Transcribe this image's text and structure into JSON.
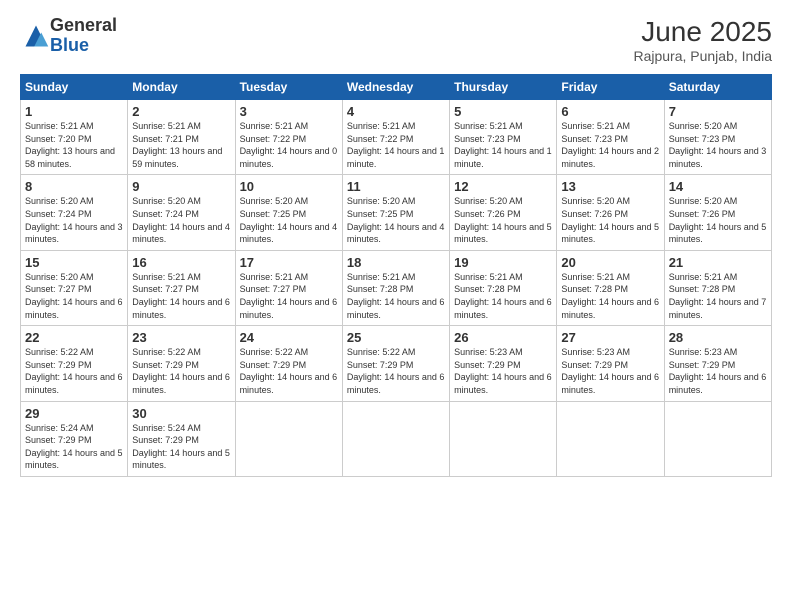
{
  "header": {
    "logo_general": "General",
    "logo_blue": "Blue",
    "month_year": "June 2025",
    "location": "Rajpura, Punjab, India"
  },
  "weekdays": [
    "Sunday",
    "Monday",
    "Tuesday",
    "Wednesday",
    "Thursday",
    "Friday",
    "Saturday"
  ],
  "weeks": [
    [
      {
        "day": "1",
        "sunrise": "Sunrise: 5:21 AM",
        "sunset": "Sunset: 7:20 PM",
        "daylight": "Daylight: 13 hours and 58 minutes."
      },
      {
        "day": "2",
        "sunrise": "Sunrise: 5:21 AM",
        "sunset": "Sunset: 7:21 PM",
        "daylight": "Daylight: 13 hours and 59 minutes."
      },
      {
        "day": "3",
        "sunrise": "Sunrise: 5:21 AM",
        "sunset": "Sunset: 7:22 PM",
        "daylight": "Daylight: 14 hours and 0 minutes."
      },
      {
        "day": "4",
        "sunrise": "Sunrise: 5:21 AM",
        "sunset": "Sunset: 7:22 PM",
        "daylight": "Daylight: 14 hours and 1 minute."
      },
      {
        "day": "5",
        "sunrise": "Sunrise: 5:21 AM",
        "sunset": "Sunset: 7:23 PM",
        "daylight": "Daylight: 14 hours and 1 minute."
      },
      {
        "day": "6",
        "sunrise": "Sunrise: 5:21 AM",
        "sunset": "Sunset: 7:23 PM",
        "daylight": "Daylight: 14 hours and 2 minutes."
      },
      {
        "day": "7",
        "sunrise": "Sunrise: 5:20 AM",
        "sunset": "Sunset: 7:23 PM",
        "daylight": "Daylight: 14 hours and 3 minutes."
      }
    ],
    [
      {
        "day": "8",
        "sunrise": "Sunrise: 5:20 AM",
        "sunset": "Sunset: 7:24 PM",
        "daylight": "Daylight: 14 hours and 3 minutes."
      },
      {
        "day": "9",
        "sunrise": "Sunrise: 5:20 AM",
        "sunset": "Sunset: 7:24 PM",
        "daylight": "Daylight: 14 hours and 4 minutes."
      },
      {
        "day": "10",
        "sunrise": "Sunrise: 5:20 AM",
        "sunset": "Sunset: 7:25 PM",
        "daylight": "Daylight: 14 hours and 4 minutes."
      },
      {
        "day": "11",
        "sunrise": "Sunrise: 5:20 AM",
        "sunset": "Sunset: 7:25 PM",
        "daylight": "Daylight: 14 hours and 4 minutes."
      },
      {
        "day": "12",
        "sunrise": "Sunrise: 5:20 AM",
        "sunset": "Sunset: 7:26 PM",
        "daylight": "Daylight: 14 hours and 5 minutes."
      },
      {
        "day": "13",
        "sunrise": "Sunrise: 5:20 AM",
        "sunset": "Sunset: 7:26 PM",
        "daylight": "Daylight: 14 hours and 5 minutes."
      },
      {
        "day": "14",
        "sunrise": "Sunrise: 5:20 AM",
        "sunset": "Sunset: 7:26 PM",
        "daylight": "Daylight: 14 hours and 5 minutes."
      }
    ],
    [
      {
        "day": "15",
        "sunrise": "Sunrise: 5:20 AM",
        "sunset": "Sunset: 7:27 PM",
        "daylight": "Daylight: 14 hours and 6 minutes."
      },
      {
        "day": "16",
        "sunrise": "Sunrise: 5:21 AM",
        "sunset": "Sunset: 7:27 PM",
        "daylight": "Daylight: 14 hours and 6 minutes."
      },
      {
        "day": "17",
        "sunrise": "Sunrise: 5:21 AM",
        "sunset": "Sunset: 7:27 PM",
        "daylight": "Daylight: 14 hours and 6 minutes."
      },
      {
        "day": "18",
        "sunrise": "Sunrise: 5:21 AM",
        "sunset": "Sunset: 7:28 PM",
        "daylight": "Daylight: 14 hours and 6 minutes."
      },
      {
        "day": "19",
        "sunrise": "Sunrise: 5:21 AM",
        "sunset": "Sunset: 7:28 PM",
        "daylight": "Daylight: 14 hours and 6 minutes."
      },
      {
        "day": "20",
        "sunrise": "Sunrise: 5:21 AM",
        "sunset": "Sunset: 7:28 PM",
        "daylight": "Daylight: 14 hours and 6 minutes."
      },
      {
        "day": "21",
        "sunrise": "Sunrise: 5:21 AM",
        "sunset": "Sunset: 7:28 PM",
        "daylight": "Daylight: 14 hours and 7 minutes."
      }
    ],
    [
      {
        "day": "22",
        "sunrise": "Sunrise: 5:22 AM",
        "sunset": "Sunset: 7:29 PM",
        "daylight": "Daylight: 14 hours and 6 minutes."
      },
      {
        "day": "23",
        "sunrise": "Sunrise: 5:22 AM",
        "sunset": "Sunset: 7:29 PM",
        "daylight": "Daylight: 14 hours and 6 minutes."
      },
      {
        "day": "24",
        "sunrise": "Sunrise: 5:22 AM",
        "sunset": "Sunset: 7:29 PM",
        "daylight": "Daylight: 14 hours and 6 minutes."
      },
      {
        "day": "25",
        "sunrise": "Sunrise: 5:22 AM",
        "sunset": "Sunset: 7:29 PM",
        "daylight": "Daylight: 14 hours and 6 minutes."
      },
      {
        "day": "26",
        "sunrise": "Sunrise: 5:23 AM",
        "sunset": "Sunset: 7:29 PM",
        "daylight": "Daylight: 14 hours and 6 minutes."
      },
      {
        "day": "27",
        "sunrise": "Sunrise: 5:23 AM",
        "sunset": "Sunset: 7:29 PM",
        "daylight": "Daylight: 14 hours and 6 minutes."
      },
      {
        "day": "28",
        "sunrise": "Sunrise: 5:23 AM",
        "sunset": "Sunset: 7:29 PM",
        "daylight": "Daylight: 14 hours and 6 minutes."
      }
    ],
    [
      {
        "day": "29",
        "sunrise": "Sunrise: 5:24 AM",
        "sunset": "Sunset: 7:29 PM",
        "daylight": "Daylight: 14 hours and 5 minutes."
      },
      {
        "day": "30",
        "sunrise": "Sunrise: 5:24 AM",
        "sunset": "Sunset: 7:29 PM",
        "daylight": "Daylight: 14 hours and 5 minutes."
      },
      {
        "day": "",
        "sunrise": "",
        "sunset": "",
        "daylight": ""
      },
      {
        "day": "",
        "sunrise": "",
        "sunset": "",
        "daylight": ""
      },
      {
        "day": "",
        "sunrise": "",
        "sunset": "",
        "daylight": ""
      },
      {
        "day": "",
        "sunrise": "",
        "sunset": "",
        "daylight": ""
      },
      {
        "day": "",
        "sunrise": "",
        "sunset": "",
        "daylight": ""
      }
    ]
  ]
}
